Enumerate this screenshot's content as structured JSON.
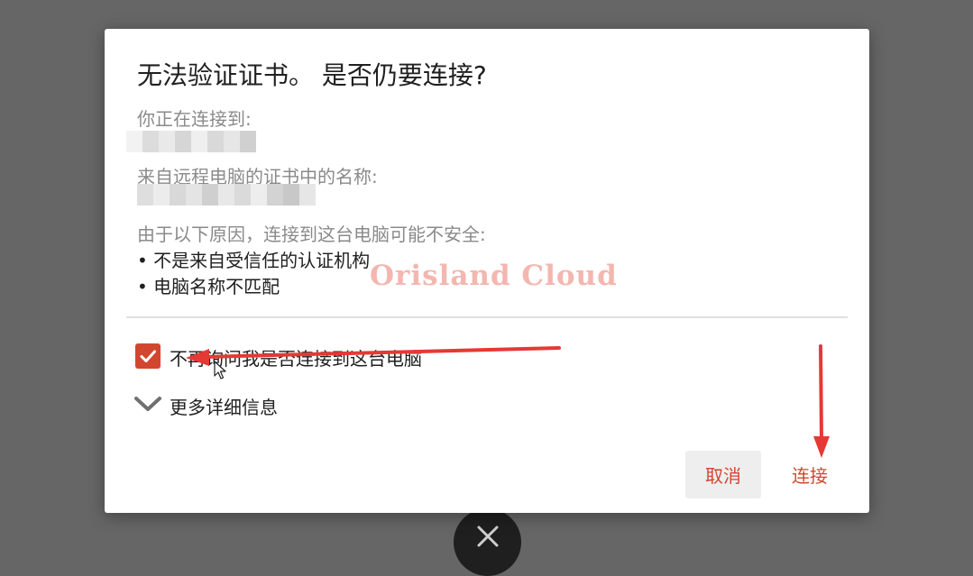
{
  "dialog": {
    "title": "无法验证证书。 是否仍要连接?",
    "connecting_to_label": "你正在连接到:",
    "cert_name_label": "来自远程电脑的证书中的名称:",
    "reason_intro": "由于以下原因，连接到这台电脑可能不安全:",
    "reasons": [
      "• 不是来自受信任的认证机构",
      "• 电脑名称不匹配"
    ],
    "dont_ask_label": "不再询问我是否连接到这台电脑",
    "dont_ask_checked": true,
    "more_details_label": "更多详细信息",
    "cancel_label": "取消",
    "connect_label": "连接"
  },
  "watermark": "Orisland Cloud",
  "colors": {
    "accent": "#d2462f",
    "annotation_arrow": "#e53935",
    "backdrop": "#666666"
  },
  "icons": {
    "close": "close-icon",
    "checkbox": "checkmark-icon",
    "expand": "chevron-down-icon",
    "pointer": "mouse-cursor-icon"
  }
}
